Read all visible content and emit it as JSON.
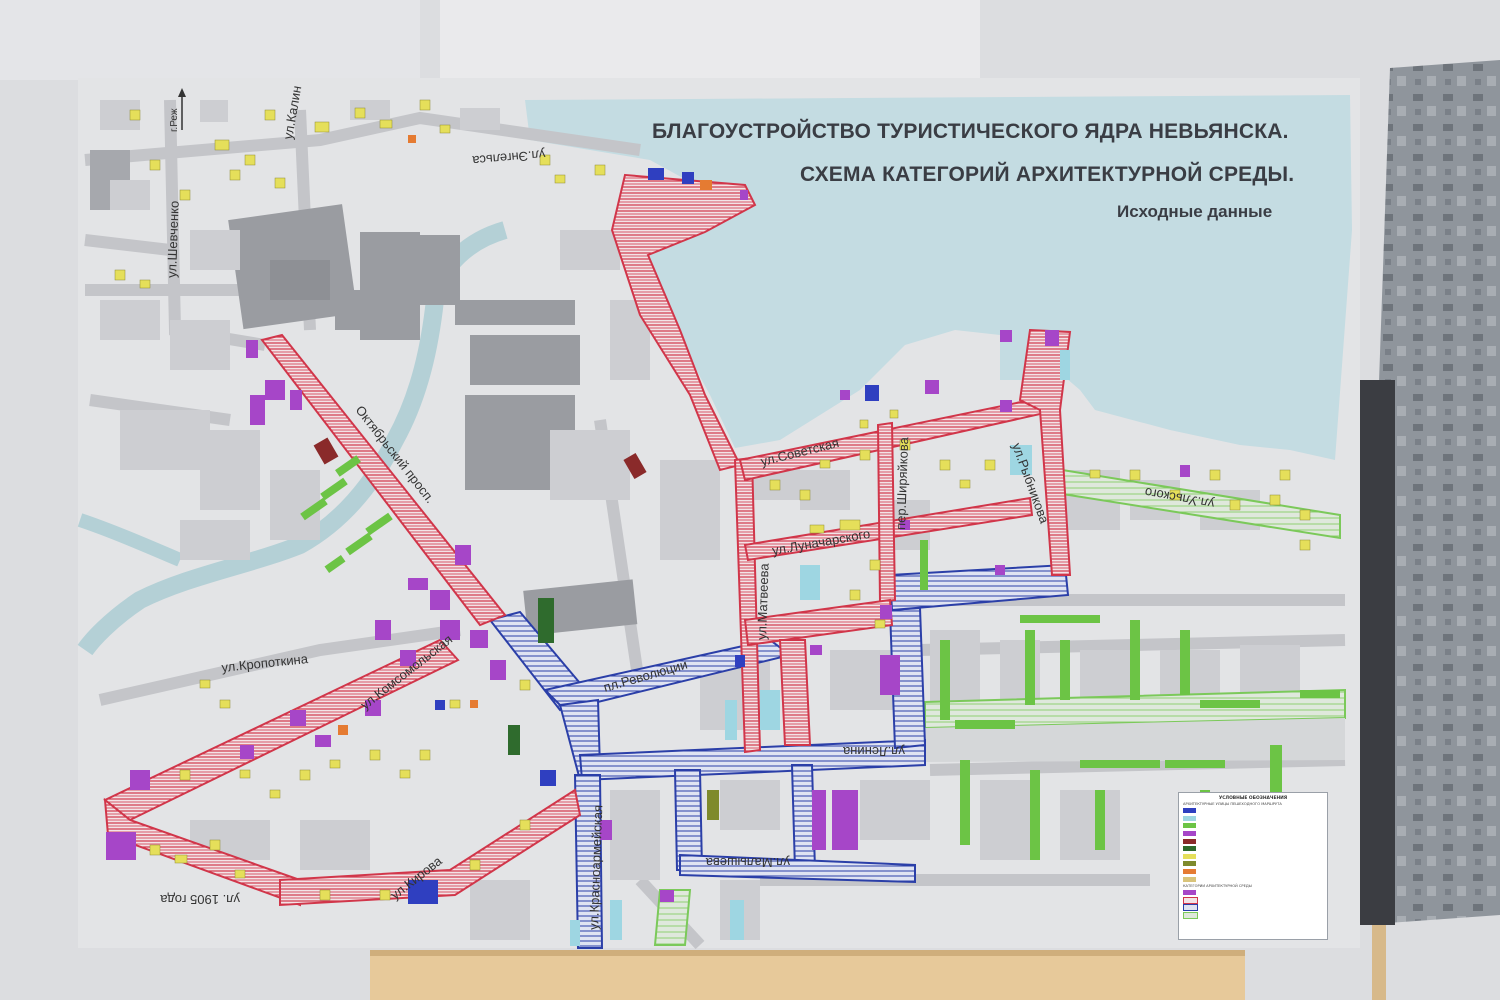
{
  "titles": {
    "line1": "БЛАГОУСТРОЙСТВО ТУРИСТИЧЕСКОГО ЯДРА НЕВЬЯНСКА.",
    "line2": "СХЕМА КАТЕГОРИЙ АРХИТЕКТУРНОЙ СРЕДЫ.",
    "line3": "Исходные данные"
  },
  "streets": {
    "shevchenko": "ул.Шевченко",
    "kalinina": "ул.Калин",
    "engelsa": "ул.Энгельса",
    "rezh": "г.Реж",
    "oktyabrsky": "Октябрьский просп.",
    "kropotkina": "ул.Кропоткина",
    "komsomolskaya": "ул.Комсомольская",
    "kirova": "ул.Кирова",
    "goda1905": "ул. 1905 года",
    "krasnoarmeyskaya": "ул.Красноармейская",
    "revolyutsii": "пл.Революции",
    "matveeva": "ул.Матвеева",
    "sovetskaya": "ул.Советская",
    "lunacharskogo": "ул.Луначарского",
    "shiryaikova": "пер.Ширяйкова",
    "lenina": "ул.Ленина",
    "malysheva": "ул.Малышева",
    "chapaeva": "ул.Рыбникова",
    "dzerzhinskogo": "ул.Дзержинского",
    "ulitskogo": "ул.Ульского"
  },
  "legend": {
    "title": "УСЛОВНЫЕ ОБОЗНАЧЕНИЯ",
    "section1": "АРХИТЕКТУРНЫЕ УЛИЦЫ ПЕШЕХОДНОГО МАРШРУТА",
    "section2": "КАТЕГОРИИ АРХИТЕКТУРНОЙ СРЕДЫ"
  },
  "colors": {
    "water": "#c4dce2",
    "paper": "#e2e3e5",
    "road": "#c7c8cb",
    "red_route": "#d1364a",
    "blue_route": "#2b3fa8",
    "green_route": "#7bc95a",
    "yellow_bldg": "#e5df5a",
    "purple_bldg": "#a646c8",
    "green_bldg": "#6cc445"
  },
  "icons": [
    "north-arrow-icon"
  ]
}
